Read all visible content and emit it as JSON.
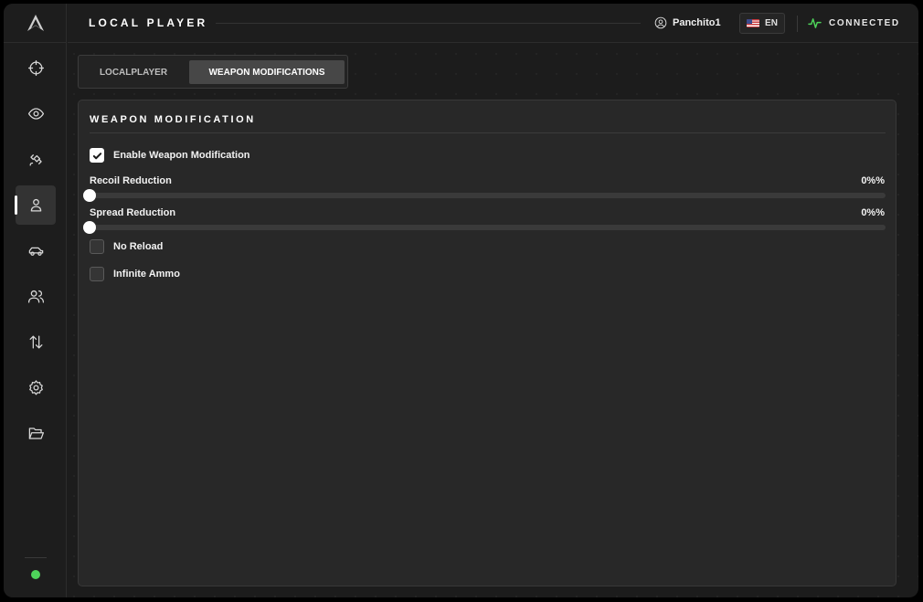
{
  "header": {
    "title": "LOCAL PLAYER",
    "username": "Panchito1",
    "language": "EN",
    "connection_status": "CONNECTED"
  },
  "sidebar": {
    "items": [
      {
        "icon": "crosshair-icon",
        "active": false
      },
      {
        "icon": "eye-icon",
        "active": false
      },
      {
        "icon": "satellite-icon",
        "active": false
      },
      {
        "icon": "user-icon",
        "active": true
      },
      {
        "icon": "car-icon",
        "active": false
      },
      {
        "icon": "users-icon",
        "active": false
      },
      {
        "icon": "arrows-up-down-icon",
        "active": false
      },
      {
        "icon": "gear-icon",
        "active": false
      },
      {
        "icon": "folder-open-icon",
        "active": false
      }
    ],
    "status_color": "#4ed35a"
  },
  "tabs": [
    {
      "label": "LOCALPLAYER",
      "active": false
    },
    {
      "label": "WEAPON MODIFICATIONS",
      "active": true
    }
  ],
  "panel": {
    "title": "WEAPON MODIFICATION",
    "enable_weapon_mod": {
      "label": "Enable Weapon Modification",
      "checked": true
    },
    "recoil": {
      "label": "Recoil Reduction",
      "value_text": "0%%",
      "value": 0
    },
    "spread": {
      "label": "Spread Reduction",
      "value_text": "0%%",
      "value": 0
    },
    "no_reload": {
      "label": "No Reload",
      "checked": false
    },
    "infinite_ammo": {
      "label": "Infinite Ammo",
      "checked": false
    }
  },
  "colors": {
    "accent_green": "#4ed35a",
    "background": "#1c1c1c",
    "panel": "#282828"
  }
}
